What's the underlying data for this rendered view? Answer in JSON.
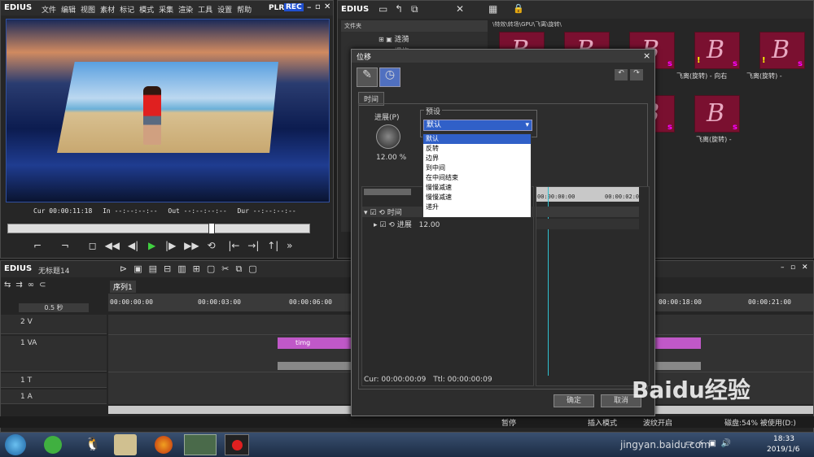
{
  "player": {
    "logo": "EDIUS",
    "menu": [
      "文件",
      "编辑",
      "视图",
      "素材",
      "标记",
      "模式",
      "采集",
      "渲染",
      "工具",
      "设置",
      "帮助"
    ],
    "plr": "PLR",
    "rec": "REC",
    "cur_label": "Cur",
    "cur_value": "00:00:11:18",
    "in_label": "In",
    "in_value": "--:--:--:--",
    "out_label": "Out",
    "out_value": "--:--:--:--",
    "dur_label": "Dur",
    "dur_value": "--:--:--:--"
  },
  "bin": {
    "logo": "EDIUS",
    "folder_label": "文件夹",
    "tree": [
      "涟漪",
      "爆炸"
    ],
    "path": "\\特效\\转场\\GPU\\飞离\\旋转\\",
    "thumbs": [
      {
        "caption": ""
      },
      {
        "caption": ""
      },
      {
        "caption": ""
      },
      {
        "caption": "飞离(旋转) - 向右"
      },
      {
        "caption": "飞离(旋转) -"
      },
      {
        "caption": ""
      },
      {
        "caption": ""
      },
      {
        "caption": "飞离(旋转) -"
      }
    ],
    "row1_captions": [
      "飞离(旋转) - 向右",
      "飞离(旋转) -"
    ],
    "row2_caption": "飞离(旋转) -"
  },
  "dialog": {
    "title": "位移",
    "close": "×",
    "tab": "时间",
    "progress_label": "进展(P)",
    "progress_value": "12.00 %",
    "preset_group": "预设",
    "preset_selected": "默认",
    "preset_options": [
      "默认",
      "反转",
      "边界",
      "到中间",
      "在中间结束",
      "慢慢减速",
      "慢慢减速",
      "递升"
    ],
    "tree_time": "时间",
    "tree_progress": "进展",
    "progress_keyval": "12.00",
    "ruler_start": "00:00:00:00",
    "ruler_end": "00:00:02:0",
    "cur_label": "Cur: 00:00:00:09",
    "ttl_label": "Ttl: 00:00:00:09",
    "ok": "确定",
    "cancel": "取消",
    "side_label": "特"
  },
  "timeline": {
    "logo": "EDIUS",
    "project": "无标题14",
    "sequence": "序列1",
    "scale": "0.5 秒",
    "ruler": [
      "00:00:00:00",
      "00:00:03:00",
      "00:00:06:00",
      "00:00:18:00",
      "00:00:21:00"
    ],
    "tracks": [
      {
        "name": "2 V"
      },
      {
        "name": "1 VA"
      },
      {
        "name": "1 T"
      },
      {
        "name": "1 A"
      }
    ],
    "clip_name": "timg"
  },
  "status": {
    "pause": "暂停",
    "insert_mode": "插入模式",
    "wave": "波纹开启",
    "disk": "磁盘:54% 被使用(D:)"
  },
  "taskbar": {
    "time": "18:33",
    "date": "2019/1/6"
  },
  "watermark": {
    "brand": "Baidu经验",
    "url": "jingyan.baidu.com"
  },
  "colors": {
    "rec": "#2050d0",
    "clip": "#c058c8",
    "select": "#3060c8",
    "play": "#40d040"
  }
}
